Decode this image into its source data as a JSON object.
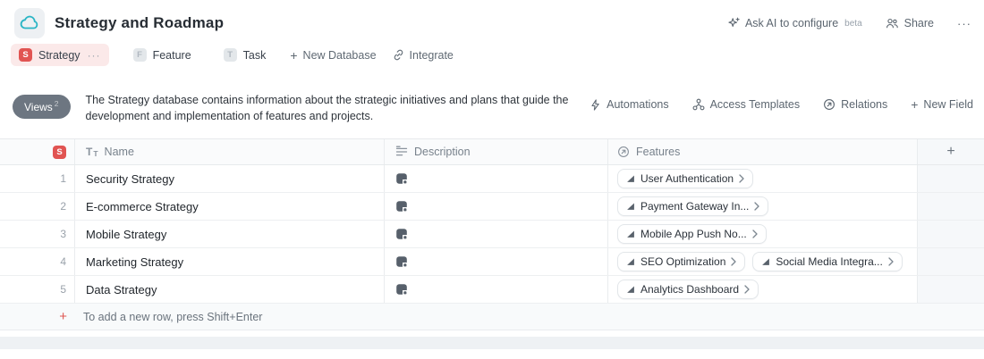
{
  "header": {
    "title": "Strategy and Roadmap",
    "ask_ai_label": "Ask AI to configure",
    "beta_label": "beta",
    "share_label": "Share",
    "more_label": "···"
  },
  "tabs": {
    "strategy": {
      "badge": "S",
      "label": "Strategy",
      "more": "···"
    },
    "feature": {
      "badge": "F",
      "label": "Feature"
    },
    "task": {
      "badge": "T",
      "label": "Task"
    },
    "new_database_label": "New Database",
    "integrate_label": "Integrate"
  },
  "toolbar": {
    "views_label": "Views",
    "views_count": "2",
    "description": "The Strategy database contains information about the strategic initiatives and plans that guide the development and implementation of features and projects.",
    "automations_label": "Automations",
    "access_templates_label": "Access Templates",
    "relations_label": "Relations",
    "new_field_label": "New Field"
  },
  "glyphs": {
    "plus": "+",
    "add_column": "+"
  },
  "table": {
    "header": {
      "badge": "S",
      "name": "Name",
      "description": "Description",
      "features": "Features"
    },
    "rows": [
      {
        "num": "1",
        "name": "Security Strategy",
        "features": [
          {
            "label": "User Authentication"
          }
        ]
      },
      {
        "num": "2",
        "name": "E-commerce Strategy",
        "features": [
          {
            "label": "Payment Gateway In..."
          }
        ]
      },
      {
        "num": "3",
        "name": "Mobile Strategy",
        "features": [
          {
            "label": "Mobile App Push No..."
          }
        ]
      },
      {
        "num": "4",
        "name": "Marketing Strategy",
        "features": [
          {
            "label": "SEO Optimization"
          },
          {
            "label": "Social Media Integra..."
          }
        ]
      },
      {
        "num": "5",
        "name": "Data Strategy",
        "features": [
          {
            "label": "Analytics Dashboard"
          }
        ]
      }
    ],
    "add_row": {
      "plus": "+",
      "hint": "To add a new row, press Shift+Enter"
    }
  },
  "colors": {
    "accent_red": "#e15452",
    "active_tab_bg": "#fbe9e9",
    "app_icon_teal": "#2ab5c5",
    "views_btn_bg": "#6d7681",
    "grid_header_bg": "#fafbfc",
    "add_column_bg": "#f6f8fa"
  }
}
